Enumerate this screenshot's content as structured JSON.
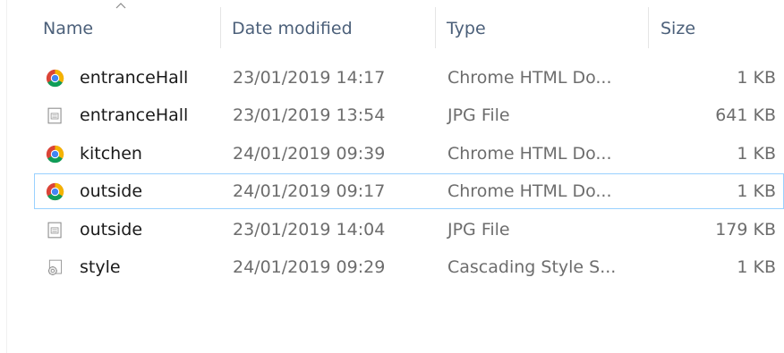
{
  "columns": {
    "name": "Name",
    "date_modified": "Date modified",
    "type": "Type",
    "size": "Size"
  },
  "sort": {
    "column": "name",
    "icon": "sort-caret-icon"
  },
  "files": [
    {
      "name": "entranceHall",
      "date": "23/01/2019 14:17",
      "type": "Chrome HTML Do...",
      "size": "1 KB",
      "icon": "chrome-icon",
      "selected": false
    },
    {
      "name": "entranceHall",
      "date": "23/01/2019 13:54",
      "type": "JPG File",
      "size": "641 KB",
      "icon": "image-file-icon",
      "selected": false
    },
    {
      "name": "kitchen",
      "date": "24/01/2019 09:39",
      "type": "Chrome HTML Do...",
      "size": "1 KB",
      "icon": "chrome-icon",
      "selected": false
    },
    {
      "name": "outside",
      "date": "24/01/2019 09:17",
      "type": "Chrome HTML Do...",
      "size": "1 KB",
      "icon": "chrome-icon",
      "selected": true
    },
    {
      "name": "outside",
      "date": "23/01/2019 14:04",
      "type": "JPG File",
      "size": "179 KB",
      "icon": "image-file-icon",
      "selected": false
    },
    {
      "name": "style",
      "date": "24/01/2019 09:29",
      "type": "Cascading Style S...",
      "size": "1 KB",
      "icon": "css-file-icon",
      "selected": false
    }
  ],
  "colors": {
    "header_text": "#4c607a",
    "detail_text": "#6d6d6d",
    "selection_border": "#99d1ff",
    "chrome_red": "#db4437",
    "chrome_green": "#0f9d58",
    "chrome_yellow": "#f4b400",
    "chrome_blue": "#4285f4"
  }
}
